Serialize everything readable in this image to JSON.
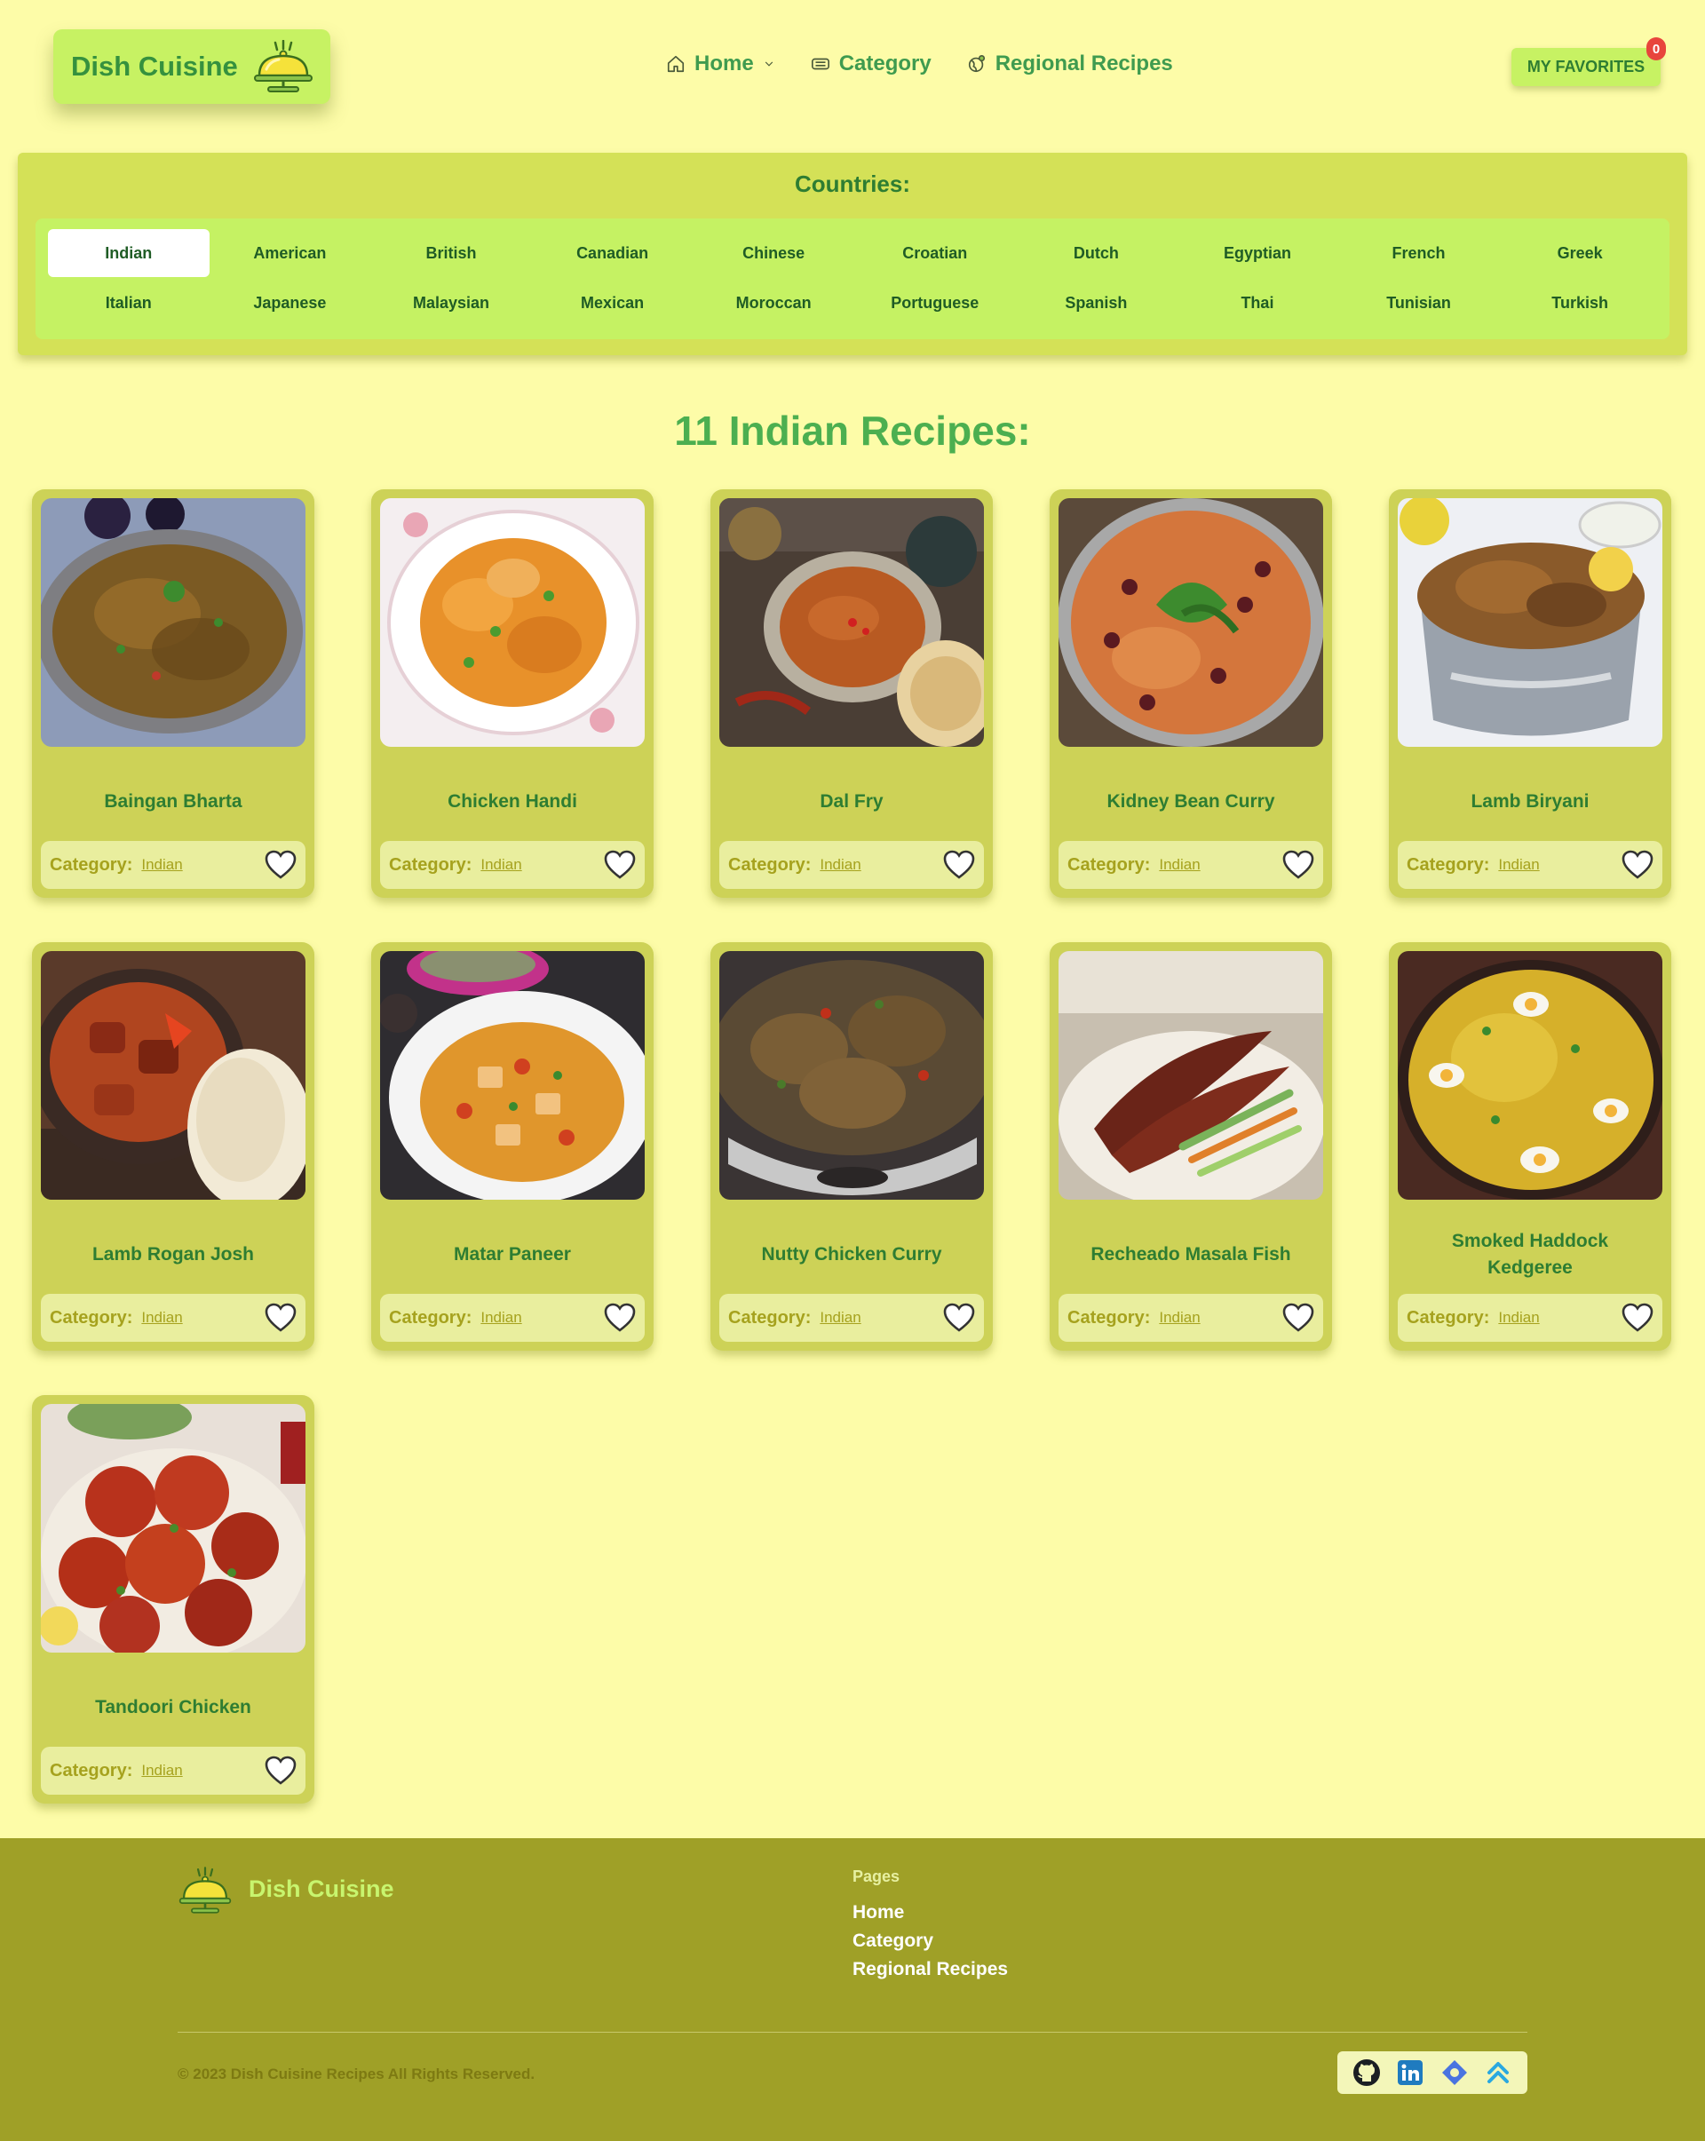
{
  "brand": {
    "name": "Dish Cuisine"
  },
  "nav": {
    "items": [
      {
        "label": "Home",
        "icon": "home-icon",
        "has_dropdown": true
      },
      {
        "label": "Category",
        "icon": "category-icon"
      },
      {
        "label": "Regional Recipes",
        "icon": "globe-icon"
      }
    ]
  },
  "favorites": {
    "label": "MY FAVORITES",
    "count": "0"
  },
  "countries": {
    "title": "Countries:",
    "selected": "Indian",
    "items": [
      "Indian",
      "American",
      "British",
      "Canadian",
      "Chinese",
      "Croatian",
      "Dutch",
      "Egyptian",
      "French",
      "Greek",
      "Italian",
      "Japanese",
      "Malaysian",
      "Mexican",
      "Moroccan",
      "Portuguese",
      "Spanish",
      "Thai",
      "Tunisian",
      "Turkish"
    ]
  },
  "recipes": {
    "title": "11 Indian Recipes:",
    "category_label": "Category:",
    "items": [
      {
        "name": "Baingan Bharta",
        "category": "Indian",
        "image": "baingan-bharta-photo"
      },
      {
        "name": "Chicken Handi",
        "category": "Indian",
        "image": "chicken-handi-photo"
      },
      {
        "name": "Dal Fry",
        "category": "Indian",
        "image": "dal-fry-photo"
      },
      {
        "name": "Kidney Bean Curry",
        "category": "Indian",
        "image": "kidney-bean-curry-photo"
      },
      {
        "name": "Lamb Biryani",
        "category": "Indian",
        "image": "lamb-biryani-photo"
      },
      {
        "name": "Lamb Rogan Josh",
        "category": "Indian",
        "image": "lamb-rogan-josh-photo"
      },
      {
        "name": "Matar Paneer",
        "category": "Indian",
        "image": "matar-paneer-photo"
      },
      {
        "name": "Nutty Chicken Curry",
        "category": "Indian",
        "image": "nutty-chicken-curry-photo"
      },
      {
        "name": "Recheado Masala Fish",
        "category": "Indian",
        "image": "recheado-masala-fish-photo"
      },
      {
        "name": "Smoked Haddock Kedgeree",
        "category": "Indian",
        "image": "smoked-haddock-kedgeree-photo"
      },
      {
        "name": "Tandoori Chicken",
        "category": "Indian",
        "image": "tandoori-chicken-photo"
      }
    ]
  },
  "footer": {
    "brand": "Dish Cuisine",
    "pages_title": "Pages",
    "links": [
      "Home",
      "Category",
      "Regional Recipes"
    ],
    "copyright": "© 2023 Dish Cuisine Recipes All Rights Reserved.",
    "socials": [
      "github-icon",
      "linkedin-icon",
      "portfolio-icon",
      "upwork-icon"
    ]
  },
  "colors": {
    "page_bg": "#fdfca8",
    "brand_green": "#35913e",
    "accent_lime": "#c7f263",
    "card_bg": "#cdd257",
    "footer_bg": "#9fa027",
    "badge_red": "#e8453c"
  }
}
